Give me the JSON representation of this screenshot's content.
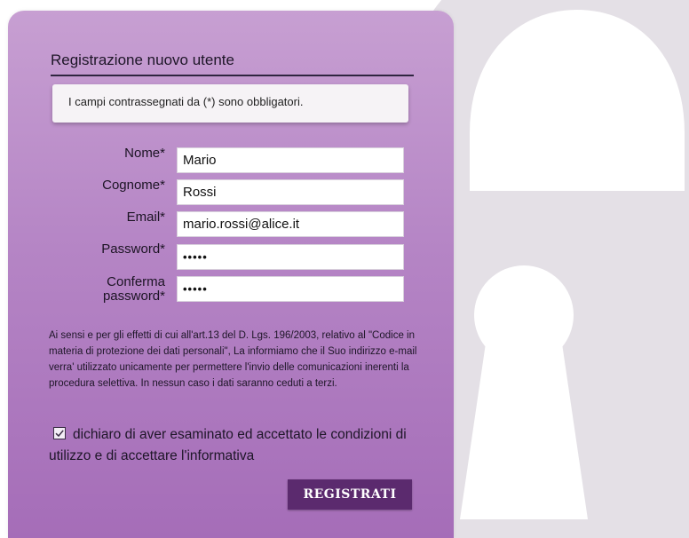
{
  "form": {
    "title": "Registrazione nuovo utente",
    "notice": "I campi contrassegnati da (*) sono obbligatori.",
    "fields": {
      "nome": {
        "label": "Nome*",
        "value": "Mario"
      },
      "cognome": {
        "label": "Cognome*",
        "value": "Rossi"
      },
      "email": {
        "label": "Email*",
        "value": "mario.rossi@alice.it"
      },
      "password": {
        "label": "Password*",
        "value": "•••••"
      },
      "conferma": {
        "label_line1": "Conferma",
        "label_line2": "password*",
        "value": "•••••"
      }
    },
    "privacy_text": "Ai sensi e per gli effetti di cui all'art.13 del D. Lgs. 196/2003, relativo al \"Codice in materia di protezione dei dati personali\", La informiamo che il Suo indirizzo e-mail verra' utilizzato unicamente per permettere l'invio delle comunicazioni inerenti la procedura selettiva. In nessun caso i dati saranno ceduti a terzi.",
    "consent_label": "dichiaro di aver esaminato ed accettato le condizioni di utilizzo e di accettare l'informativa",
    "consent_checked": true,
    "submit_label": "REGISTRATI"
  },
  "colors": {
    "card_gradient_top": "#c79fd2",
    "card_gradient_bottom": "#a56db8",
    "button": "#5b2a6e",
    "padlock": "#e4e0e6"
  },
  "icons": {
    "background": "padlock-icon",
    "consent": "checkmark-icon"
  }
}
